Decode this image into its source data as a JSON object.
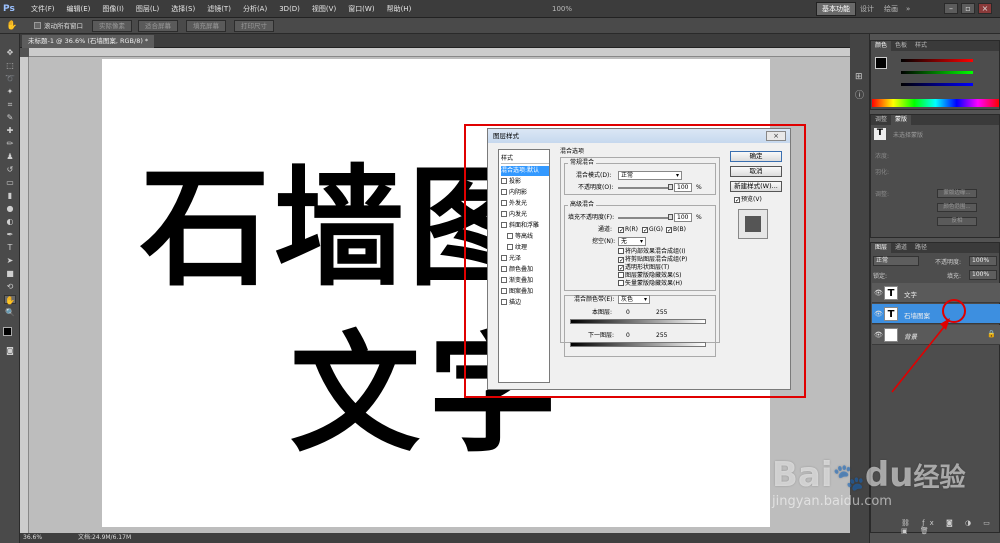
{
  "menubar": {
    "logo": "Ps",
    "items": [
      "文件(F)",
      "编辑(E)",
      "图像(I)",
      "图层(L)",
      "选择(S)",
      "滤镜(T)",
      "分析(A)",
      "3D(D)",
      "视图(V)",
      "窗口(W)",
      "帮助(H)"
    ],
    "zoom": "100%",
    "workspace": "基本功能",
    "workspace_items": [
      "设计",
      "绘画"
    ],
    "more": "»"
  },
  "options_bar": {
    "scroll_all": "滚动所有窗口",
    "buttons": [
      "实际像素",
      "适合屏幕",
      "填充屏幕",
      "打印尺寸"
    ]
  },
  "document": {
    "tab_title": "未标题-1 @ 36.6% (石墙图案, RGB/8) *",
    "text_line1": "石墙图",
    "text_line2": "文字",
    "zoom_status": "36.6%",
    "doc_size": "文档:24.9M/6.17M"
  },
  "dialog": {
    "title": "图层样式",
    "close": "×",
    "styles_header": "样式",
    "styles": [
      {
        "label": "混合选项:默认",
        "checkbox": false
      },
      {
        "label": "投影",
        "checkbox": true
      },
      {
        "label": "内阴影",
        "checkbox": true
      },
      {
        "label": "外发光",
        "checkbox": true
      },
      {
        "label": "内发光",
        "checkbox": true
      },
      {
        "label": "斜面和浮雕",
        "checkbox": true
      },
      {
        "label": "等高线",
        "checkbox": true
      },
      {
        "label": "纹理",
        "checkbox": true
      },
      {
        "label": "光泽",
        "checkbox": true
      },
      {
        "label": "颜色叠加",
        "checkbox": true
      },
      {
        "label": "渐变叠加",
        "checkbox": true
      },
      {
        "label": "图案叠加",
        "checkbox": true
      },
      {
        "label": "描边",
        "checkbox": true
      }
    ],
    "blend_options_title": "混合选项",
    "general_blend": "常规混合",
    "blend_mode_label": "混合模式(D):",
    "blend_mode_value": "正常",
    "opacity_label": "不透明度(O):",
    "opacity_value": "100",
    "percent": "%",
    "advanced_blend": "高级混合",
    "fill_opacity_label": "填充不透明度(F):",
    "fill_opacity_value": "100",
    "channels_label": "通道:",
    "channel_r": "R(R)",
    "channel_g": "G(G)",
    "channel_b": "B(B)",
    "knockout_label": "挖空(N):",
    "knockout_value": "无",
    "adv_checks": [
      {
        "label": "将内部效果混合成组(I)",
        "checked": false
      },
      {
        "label": "将剪贴图层混合成组(P)",
        "checked": true
      },
      {
        "label": "透明形状图层(T)",
        "checked": true
      },
      {
        "label": "图层蒙版隐藏效果(S)",
        "checked": false
      },
      {
        "label": "矢量蒙版隐藏效果(H)",
        "checked": false
      }
    ],
    "blend_if_label": "混合颜色带(E):",
    "blend_if_value": "灰色",
    "this_layer_label": "本图层:",
    "underlying_label": "下一图层:",
    "range_min": "0",
    "range_max": "255",
    "ok": "确定",
    "cancel": "取消",
    "new_style": "新建样式(W)...",
    "preview": "预览(V)"
  },
  "color_panel": {
    "tabs": [
      "颜色",
      "色板",
      "样式"
    ]
  },
  "adjust_panel": {
    "tabs": [
      "调整",
      "蒙版"
    ],
    "rows": [
      "未选择蒙版",
      "浓度:",
      "羽化:",
      "调整:"
    ],
    "buttons": [
      "蒙版边缘...",
      "颜色范围...",
      "反相"
    ]
  },
  "layers_panel": {
    "tabs": [
      "图层",
      "通道",
      "路径"
    ],
    "blend_mode": "正常",
    "opacity_label": "不透明度:",
    "opacity_value": "100%",
    "lock_label": "锁定:",
    "fill_label": "填充:",
    "fill_value": "100%",
    "layers": [
      {
        "name": "文字",
        "selected": false
      },
      {
        "name": "石墙图案",
        "selected": true
      },
      {
        "name": "背景",
        "selected": false
      }
    ]
  },
  "watermark": {
    "brand": "Bai",
    "brand2": "du",
    "brand_cn": "经验",
    "url": "jingyan.baidu.com"
  },
  "annotation_colors": {
    "highlight": "#e00000",
    "selection": "#3d8fe0"
  }
}
